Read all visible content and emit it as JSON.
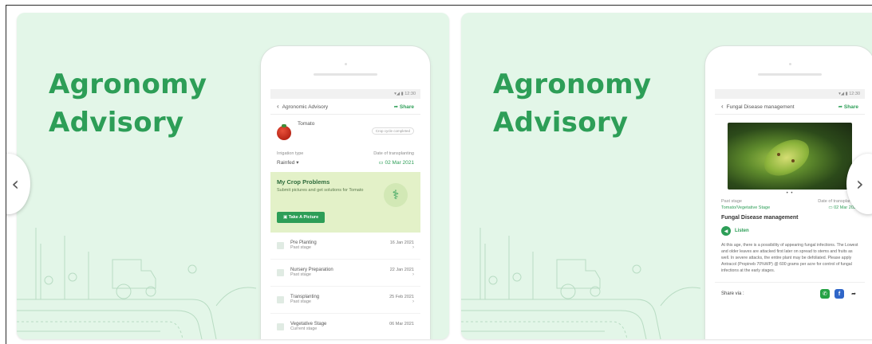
{
  "card1": {
    "title_line1": "Agronomy",
    "title_line2": "Advisory",
    "status": "12:30",
    "appbar_title": "Agronomic Advisory",
    "share": "Share",
    "crop": "Tomato",
    "chip": "Crop cycle completed",
    "irrigation_label": "Irrigation type",
    "irrigation_value": "Rainfed",
    "transplant_label": "Date of transplanting",
    "transplant_value": "02 Mar 2021",
    "problems_title": "My Crop Problems",
    "problems_desc": "Submit pictures and get solutions for Tomato",
    "take_picture": "Take A Picture",
    "stages": [
      {
        "title": "Pre Planting",
        "sub": "Past stage",
        "date": "16 Jan 2021"
      },
      {
        "title": "Nursery Preparation",
        "sub": "Past stage",
        "date": "22 Jan 2021"
      },
      {
        "title": "Transplanting",
        "sub": "Past stage",
        "date": "25 Feb 2021"
      },
      {
        "title": "Vegetative Stage",
        "sub": "Current stage",
        "date": "06 Mar 2021"
      }
    ]
  },
  "card2": {
    "title_line1": "Agronomy",
    "title_line2": "Advisory",
    "status": "12:30",
    "appbar_title": "Fungal Disease management",
    "share": "Share",
    "dots": "• •",
    "stage_label": "Past stage",
    "stage_value": "Tomato/Vegetative Stage",
    "transplant_label": "Date of transplanting",
    "transplant_value": "02 Mar 2021",
    "section_title": "Fungal Disease management",
    "listen": "Listen",
    "paragraph": "At this age, there is a possibility of appearing fungal infections. The Lowest and older leaves are attacked first later on spread to stems and fruits as well. In severe attacks, the entire plant may be defoliated. Please apply Antracol (Propineb 70%WP) @ 600 grams per acre for control of fungal infections at the early stages.",
    "share_via": "Share via :"
  },
  "nav": {
    "prev_icon": "chevron-left-icon",
    "next_icon": "chevron-right-icon"
  },
  "colors": {
    "accent": "#2d9e57",
    "card_bg": "#e3f6e8"
  }
}
